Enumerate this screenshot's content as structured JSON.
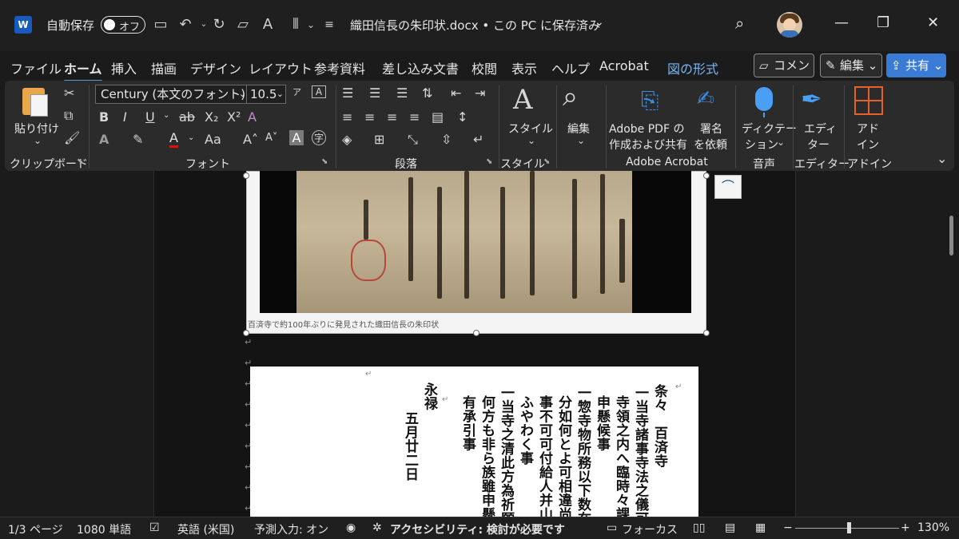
{
  "titlebar": {
    "app_icon": "word-icon",
    "autosave_label": "自動保存",
    "autosave_state": "オフ",
    "doc_title": "織田信長の朱印状.docx • この PC に保存済み",
    "icons": [
      "save-icon",
      "undo-icon",
      "redo-icon",
      "comment-icon",
      "read-aloud-icon",
      "layout-icon",
      "customize-icon",
      "search-icon",
      "minimize-icon",
      "restore-icon",
      "close-icon"
    ]
  },
  "tabs": [
    "ファイル",
    "ホーム",
    "挿入",
    "描画",
    "デザイン",
    "レイアウト",
    "参考資料",
    "差し込み文書",
    "校閲",
    "表示",
    "ヘルプ",
    "Acrobat",
    "図の形式"
  ],
  "active_tab": "ホーム",
  "actions": {
    "comment": "コメント",
    "edit": "編集",
    "share": "共有"
  },
  "ribbon": {
    "clipboard": {
      "paste": "貼り付け",
      "group": "クリップボード"
    },
    "font": {
      "font_name": "Century (本文のフォント)",
      "font_size": "10.5",
      "group": "フォント",
      "superscript": "X²",
      "subscript": "X₂",
      "aa": "Aa"
    },
    "paragraph": {
      "group": "段落"
    },
    "style": {
      "label": "スタイル",
      "group": "スタイル"
    },
    "edit": {
      "label": "編集"
    },
    "acrobat": {
      "create_label_1": "Adobe PDF の",
      "create_label_2": "作成および共有",
      "sign_label_1": "署名",
      "sign_label_2": "を依頼",
      "group": "Adobe Acrobat"
    },
    "voice": {
      "label_1": "ディクテー",
      "label_2": "ション",
      "group": "音声"
    },
    "editor": {
      "label_1": "エディ",
      "label_2": "ター",
      "group": "エディター"
    },
    "addins": {
      "label_1": "アド",
      "label_2": "イン",
      "group": "アドイン"
    }
  },
  "document": {
    "image_caption": "百済寺で約100年ぶりに発見された織田信長の朱印状",
    "columns": [
      "条々　百済寺",
      "一当寺諸事寺法之儀可為",
      "寺領之内へ臨時々課役",
      "申懸候事",
      "一惣寺物所務以下数在所",
      "分如何とよ可相違尚以",
      "事不可可付給人并山林",
      "ふやわく事",
      "一当寺之清此方為祈願所",
      "何方も非ら族雖申懸義",
      "有承引事",
      "永禄",
      "五月廿二日"
    ]
  },
  "status": {
    "page": "1/3 ページ",
    "words": "1080 単語",
    "language": "英語 (米国)",
    "predictive": "予測入力: オン",
    "accessibility": "アクセシビリティ: 検討が必要です",
    "focus": "フォーカス",
    "zoom": "130%",
    "zoom_level": 1.3
  },
  "colors": {
    "accent": "#5b9bd5",
    "share": "#3a7bd5",
    "picture_format_tab": "#79b4f5",
    "seal_red": "#b8463a"
  }
}
